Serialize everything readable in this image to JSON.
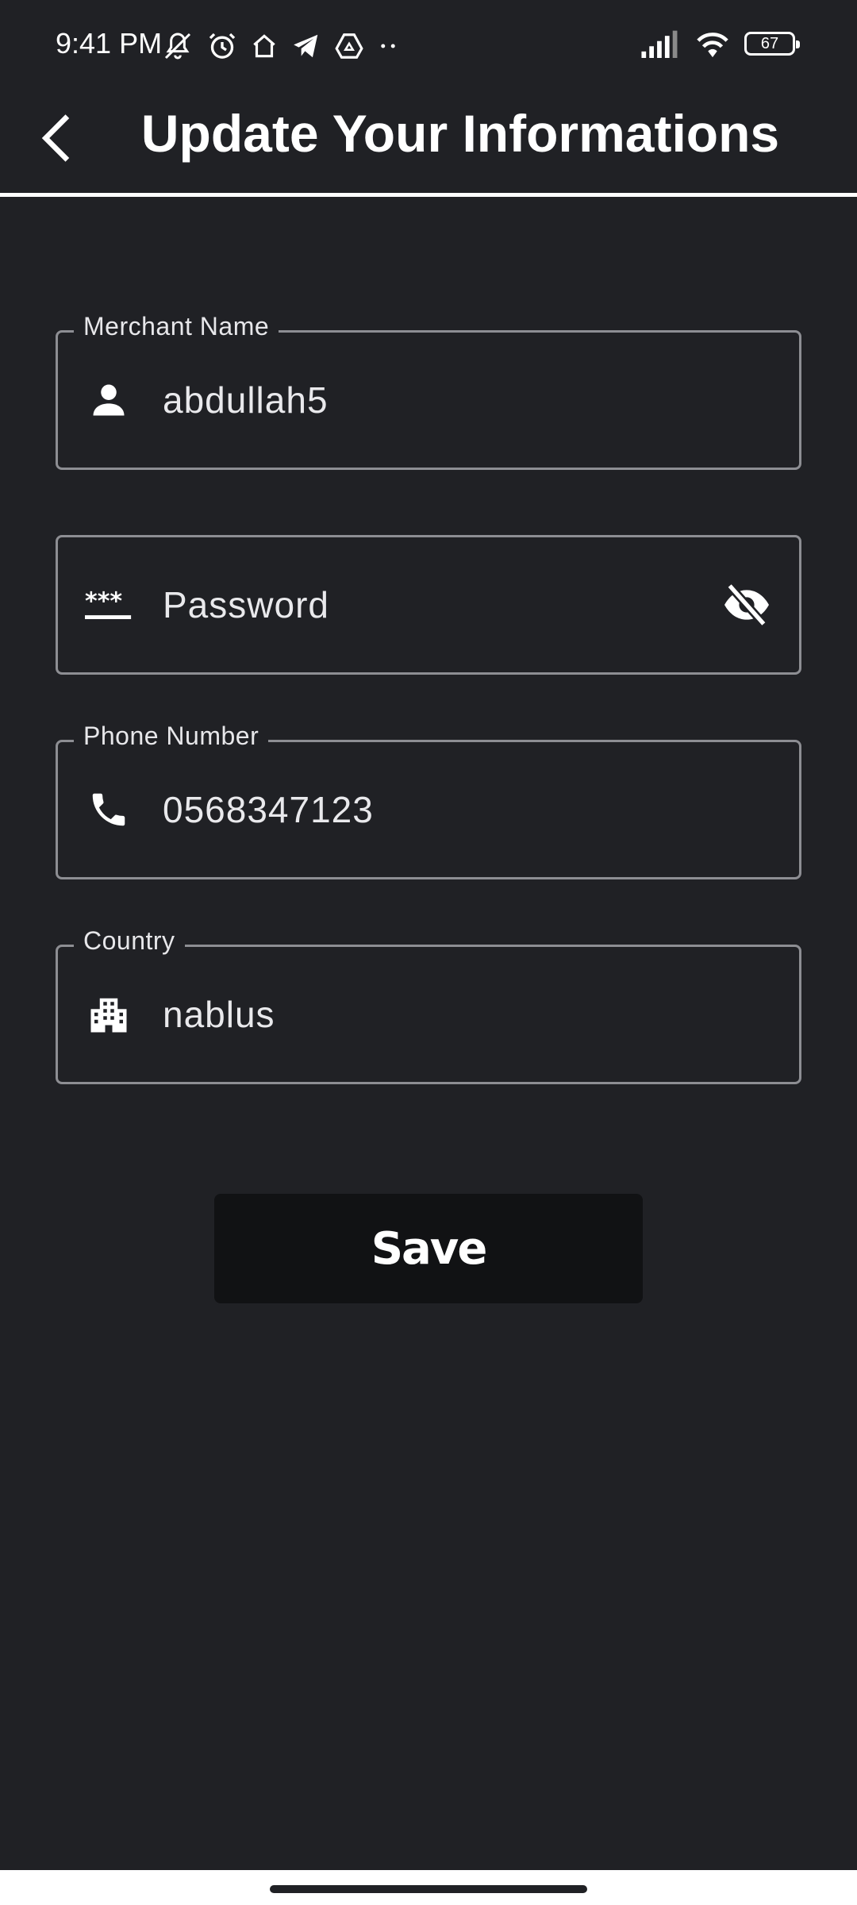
{
  "status_bar": {
    "time": "9:41 PM",
    "battery_level": "67",
    "icons": [
      "mute-icon",
      "alarm-icon",
      "home-icon",
      "telegram-icon",
      "drive-icon",
      "more-dots-icon",
      "signal-icon",
      "wifi-icon",
      "battery-icon"
    ]
  },
  "header": {
    "title": "Update Your Informations",
    "back_icon": "back-arrow-icon"
  },
  "form": {
    "merchant_name": {
      "label": "Merchant Name",
      "value": "abdullah5",
      "icon": "person-icon"
    },
    "password": {
      "placeholder": "Password",
      "icon": "password-icon",
      "toggle_icon": "visibility-off-icon"
    },
    "phone_number": {
      "label": "Phone Number",
      "value": "0568347123",
      "icon": "phone-icon"
    },
    "country": {
      "label": "Country",
      "value": "nablus",
      "icon": "city-icon"
    },
    "save_label": "Save"
  },
  "colors": {
    "background": "#202125",
    "field_border": "#8d8e93",
    "button_background": "#111214",
    "text": "#ffffff"
  }
}
